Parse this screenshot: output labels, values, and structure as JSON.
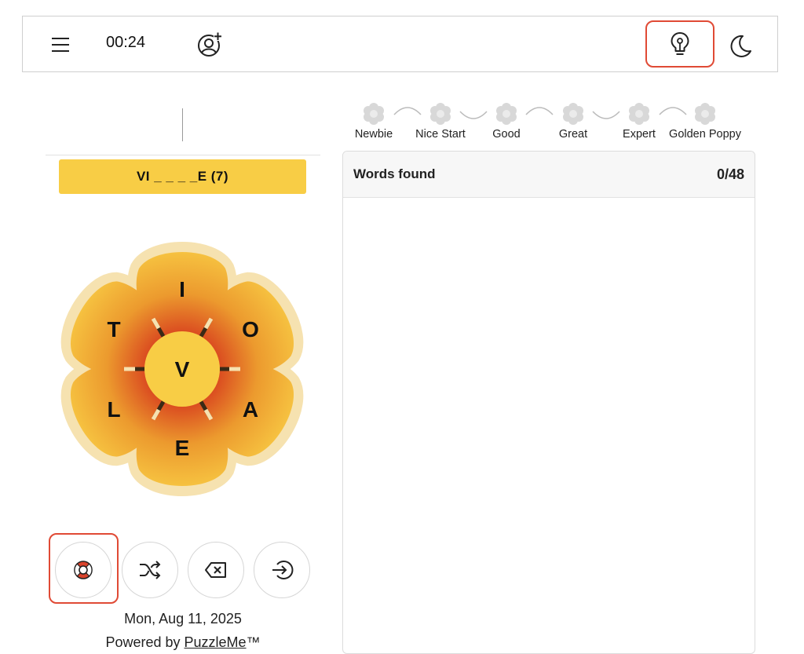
{
  "topbar": {
    "timer": "00:24",
    "icons": {
      "menu": "hamburger-menu-icon",
      "add_player": "add-user-icon",
      "hint": "lightbulb-icon",
      "theme": "moon-icon"
    }
  },
  "puzzle": {
    "current_input": "",
    "clue": "VI _ _ _ _E (7)",
    "center_letter": "V",
    "outer_letters": [
      "I",
      "O",
      "A",
      "E",
      "L",
      "T"
    ]
  },
  "controls": [
    {
      "name": "hint",
      "icon": "lifebuoy-icon"
    },
    {
      "name": "shuffle",
      "icon": "shuffle-icon"
    },
    {
      "name": "delete",
      "icon": "backspace-icon"
    },
    {
      "name": "submit",
      "icon": "enter-icon"
    }
  ],
  "footer": {
    "date": "Mon, Aug 11, 2025",
    "powered_prefix": "Powered by",
    "brand": "PuzzleMe",
    "trademark": "™"
  },
  "ranks": [
    "Newbie",
    "Nice Start",
    "Good",
    "Great",
    "Expert",
    "Golden Poppy"
  ],
  "words_panel": {
    "title": "Words found",
    "count": "0/48"
  },
  "colors": {
    "accent": "#f8cd45",
    "highlight_border": "#e04a35",
    "petal_outer": "#f0b43a",
    "petal_inner": "#e0592a",
    "halo": "#f6e2b0"
  }
}
